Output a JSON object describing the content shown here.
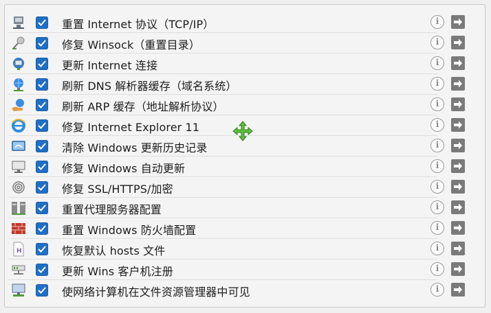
{
  "items": [
    {
      "label": "重置 Internet 协议（TCP/IP）",
      "icon": "network-adapter-icon",
      "checked": true
    },
    {
      "label": "修复 Winsock（重置目录）",
      "icon": "socket-plug-icon",
      "checked": true
    },
    {
      "label": "更新 Internet 连接",
      "icon": "globe-monitor-icon",
      "checked": true
    },
    {
      "label": "刷新 DNS 解析器缓存（域名系统）",
      "icon": "globe-network-icon",
      "checked": true
    },
    {
      "label": "刷新 ARP 缓存（地址解析协议）",
      "icon": "network-hand-icon",
      "checked": true
    },
    {
      "label": "修复 Internet Explorer 11",
      "icon": "internet-explorer-icon",
      "checked": true
    },
    {
      "label": "清除 Windows 更新历史记录",
      "icon": "windows-update-icon",
      "checked": true
    },
    {
      "label": "修复 Windows 自动更新",
      "icon": "monitor-icon",
      "checked": true
    },
    {
      "label": "修复 SSL/HTTPS/加密",
      "icon": "fingerprint-icon",
      "checked": true
    },
    {
      "label": "重置代理服务器配置",
      "icon": "proxy-servers-icon",
      "checked": true
    },
    {
      "label": "重置 Windows 防火墙配置",
      "icon": "firewall-brick-icon",
      "checked": true
    },
    {
      "label": "恢复默认 hosts 文件",
      "icon": "hosts-file-icon",
      "checked": true
    },
    {
      "label": "更新 Wins 客户机注册",
      "icon": "wins-network-icon",
      "checked": true
    },
    {
      "label": "使网络计算机在文件资源管理器中可见",
      "icon": "network-computer-icon",
      "checked": true
    }
  ],
  "info_glyph": "i",
  "colors": {
    "checkbox": "#1f6fc5",
    "cursor": "#5cc13a"
  }
}
